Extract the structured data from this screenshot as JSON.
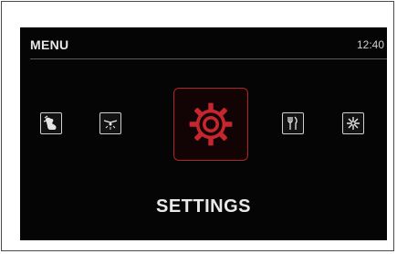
{
  "header": {
    "title": "MENU",
    "time": "12:40"
  },
  "menu_items": [
    {
      "icon": "hand-tap-icon",
      "selected": false
    },
    {
      "icon": "light-icon",
      "selected": false
    },
    {
      "icon": "gear-icon",
      "selected": true,
      "label": "SETTINGS"
    },
    {
      "icon": "utensils-icon",
      "selected": false
    },
    {
      "icon": "snowflake-icon",
      "selected": false
    }
  ],
  "selected_label": "SETTINGS",
  "colors": {
    "screen_bg": "#050505",
    "accent": "#b1242a",
    "text": "#e9e9e9"
  }
}
